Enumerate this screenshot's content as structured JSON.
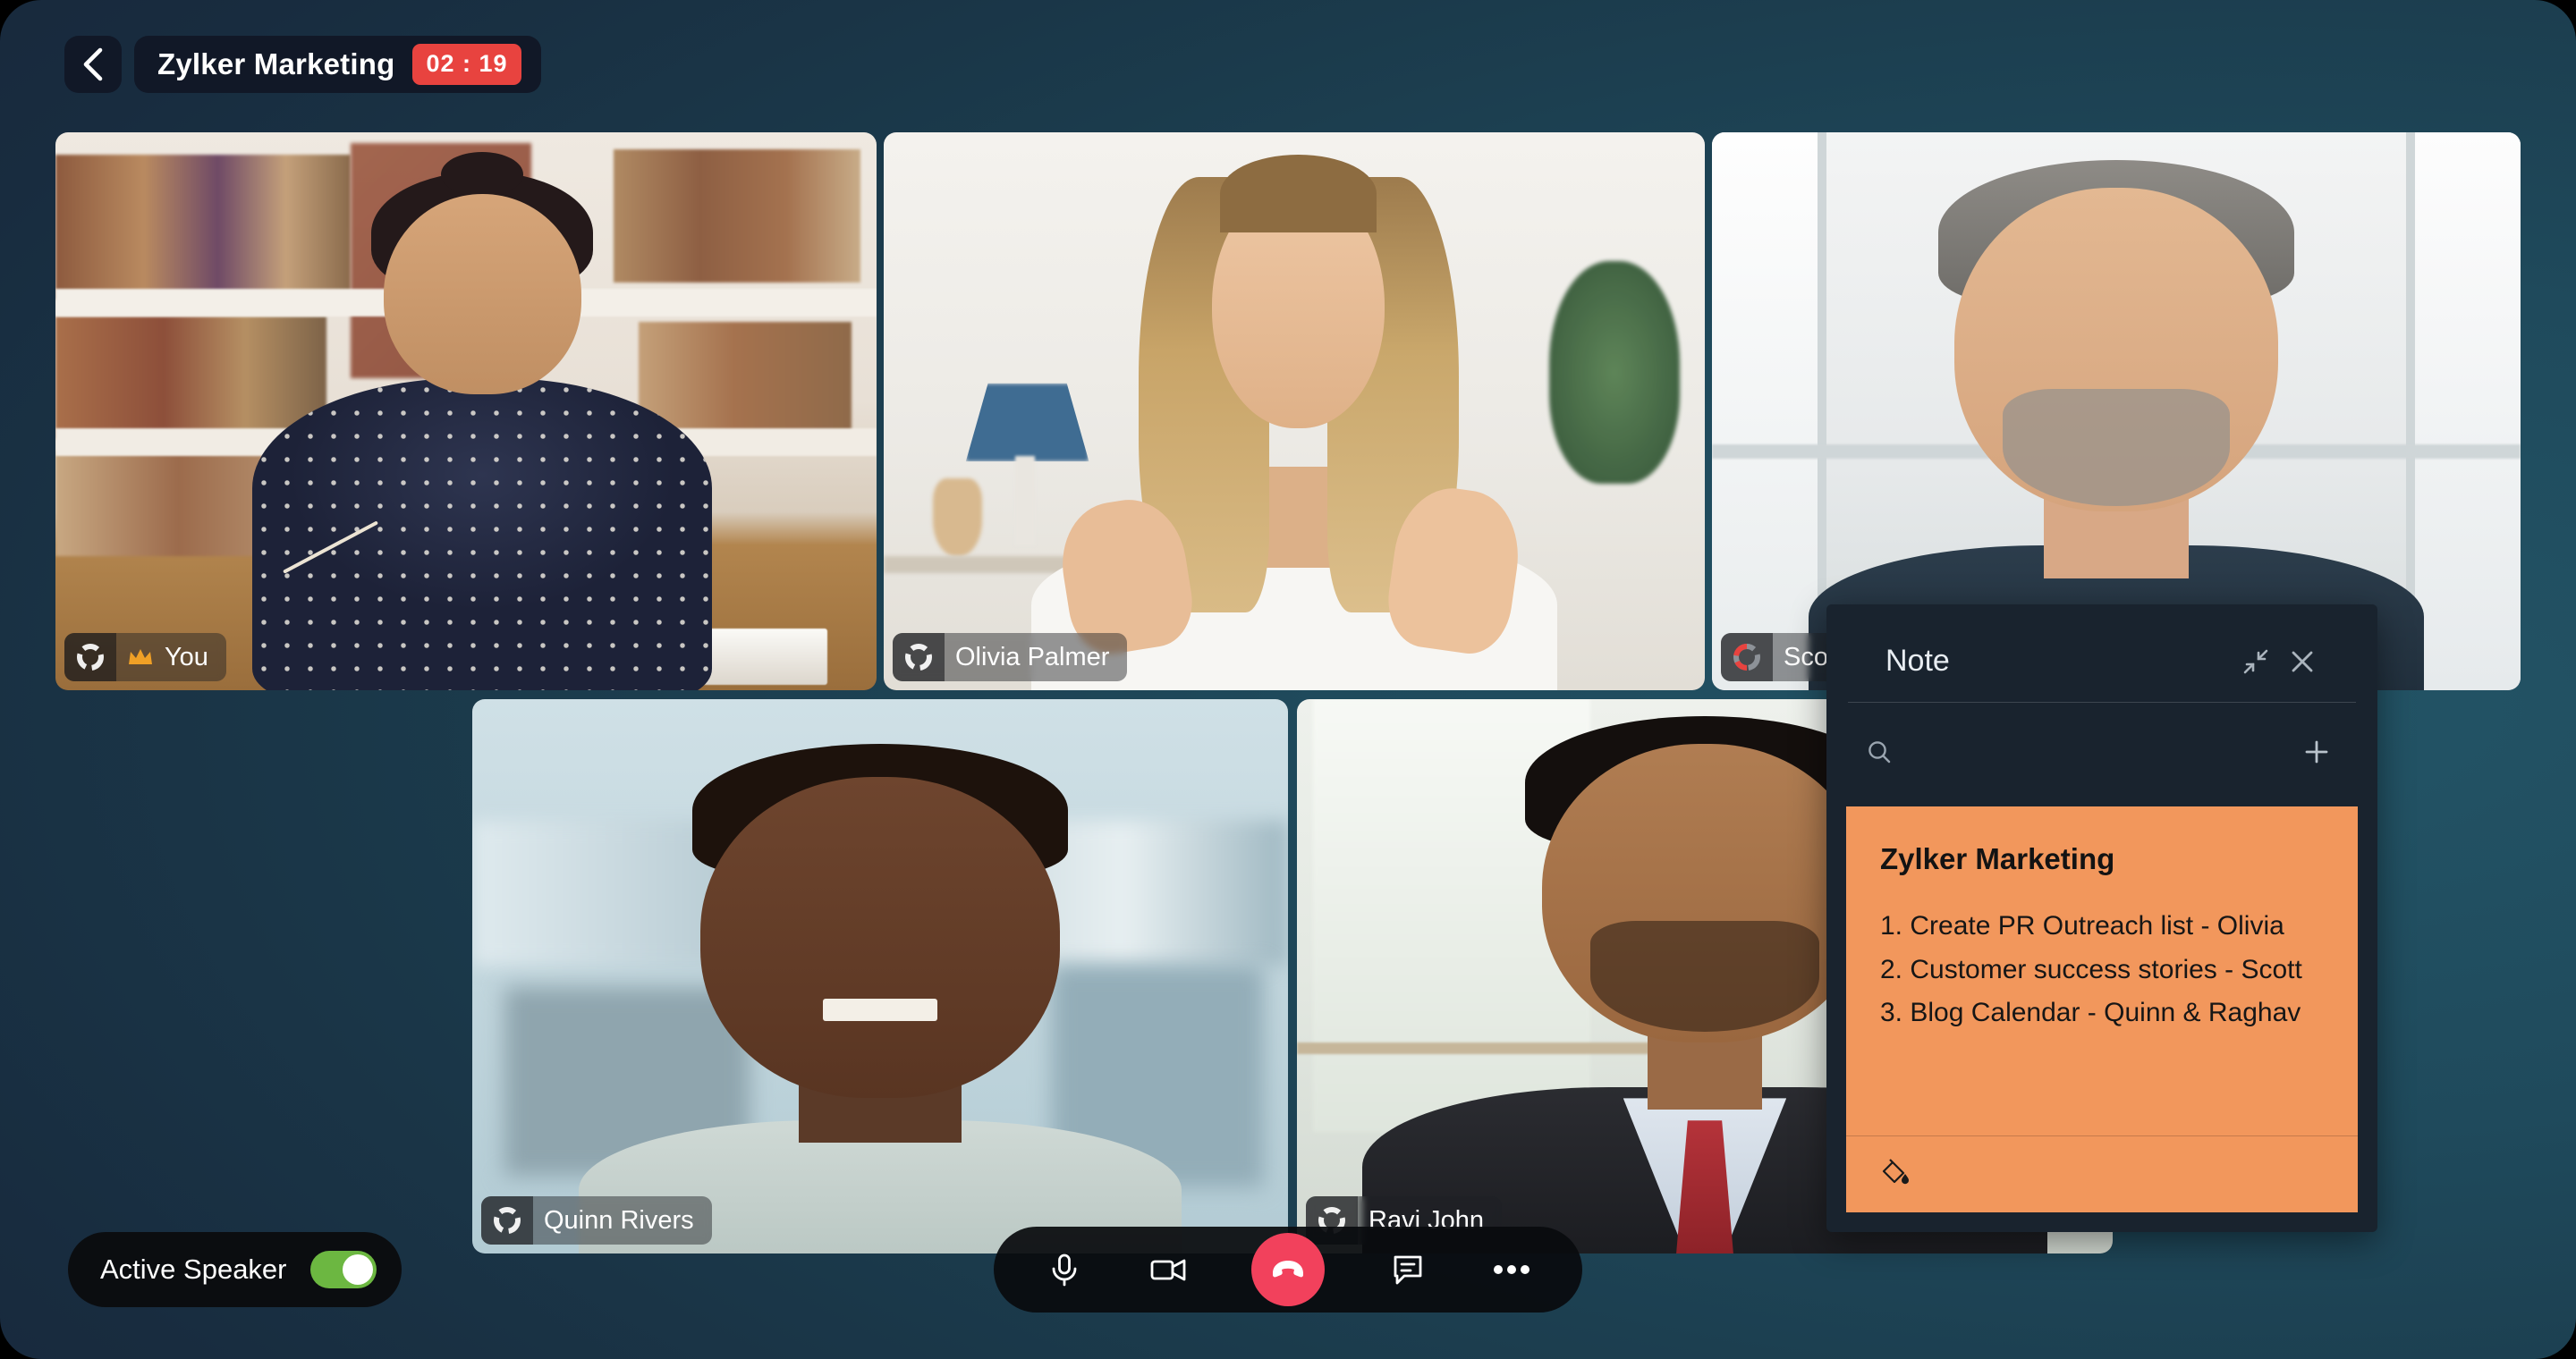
{
  "header": {
    "back_label": "Back",
    "back_icon": "chevron-left-icon",
    "title": "Zylker Marketing",
    "timer": "02 : 19"
  },
  "participants": [
    {
      "name": "You",
      "badge": "host-crown-icon",
      "audio_state": "active",
      "audio_icon": "audio-ring-icon"
    },
    {
      "name": "Olivia Palmer",
      "badge": "",
      "audio_state": "active",
      "audio_icon": "audio-ring-icon"
    },
    {
      "name": "Scott",
      "badge": "",
      "audio_state": "speaking",
      "audio_icon": "audio-ring-icon"
    },
    {
      "name": "Quinn Rivers",
      "badge": "",
      "audio_state": "active",
      "audio_icon": "audio-ring-icon"
    },
    {
      "name": "Ravi John",
      "badge": "",
      "audio_state": "active",
      "audio_icon": "audio-ring-icon"
    }
  ],
  "note_panel": {
    "title": "Note",
    "minimize_icon": "collapse-arrows-icon",
    "close_icon": "close-icon",
    "search_icon": "search-icon",
    "search_value": "",
    "search_placeholder": "",
    "add_icon": "plus-icon",
    "card": {
      "heading": "Zylker Marketing",
      "items": [
        "1. Create PR Outreach list - Olivia",
        "2. Customer success stories - Scott",
        "3. Blog Calendar - Quinn & Raghav"
      ],
      "color_icon": "paint-bucket-icon",
      "background_color": "#f2975c"
    }
  },
  "active_speaker": {
    "label": "Active Speaker",
    "enabled": true,
    "on_color": "#6cb741"
  },
  "call_bar": {
    "mic_label": "Mute",
    "mic_icon": "microphone-icon",
    "camera_label": "Stop video",
    "camera_icon": "video-camera-icon",
    "end_label": "End call",
    "end_icon": "phone-hangup-icon",
    "end_color": "#f2415c",
    "chat_label": "Chat",
    "chat_icon": "chat-bubble-icon",
    "more_label": "More options",
    "more_icon": "more-dots-icon"
  },
  "theme": {
    "timer_color": "#e8433f",
    "panel_bg": "#19232e",
    "chip_bg": "rgba(30,33,38,.46)"
  }
}
